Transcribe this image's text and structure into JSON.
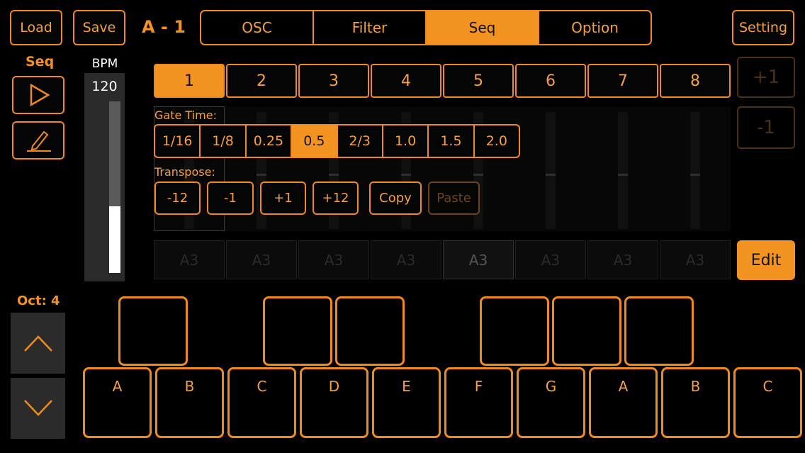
{
  "header": {
    "load_label": "Load",
    "save_label": "Save",
    "preset_name": "A - 1",
    "tabs": [
      {
        "label": "OSC",
        "active": false
      },
      {
        "label": "Filter",
        "active": false
      },
      {
        "label": "Seq",
        "active": true
      },
      {
        "label": "Option",
        "active": false
      }
    ],
    "setting_label": "Setting"
  },
  "left_panel": {
    "seq_label": "Seq",
    "play_icon": "play-icon",
    "edit_icon": "pencil-icon"
  },
  "bpm": {
    "label": "BPM",
    "value": "120",
    "level_fraction": 0.39
  },
  "steps": {
    "items": [
      "1",
      "2",
      "3",
      "4",
      "5",
      "6",
      "7",
      "8"
    ],
    "selected": "1",
    "plus_label": "+1",
    "minus_label": "-1"
  },
  "gate_time": {
    "label": "Gate Time:",
    "options": [
      "1/16",
      "1/8",
      "0.25",
      "0.5",
      "2/3",
      "1.0",
      "1.5",
      "2.0"
    ],
    "selected": "0.5"
  },
  "transpose": {
    "label": "Transpose:",
    "buttons": [
      "-12",
      "-1",
      "+1",
      "+12"
    ],
    "copy_label": "Copy",
    "paste_label": "Paste"
  },
  "notes": {
    "items": [
      "A3",
      "A3",
      "A3",
      "A3",
      "A3",
      "A3",
      "A3",
      "A3"
    ],
    "edit_label": "Edit"
  },
  "keyboard": {
    "octave_label": "Oct: 4",
    "up_icon": "chevron-up-icon",
    "down_icon": "chevron-down-icon",
    "white_keys": [
      "A",
      "B",
      "C",
      "D",
      "E",
      "F",
      "G",
      "A",
      "B",
      "C"
    ],
    "black_key_count": 6
  },
  "colors": {
    "accent": "#f39321",
    "background": "#000000"
  }
}
